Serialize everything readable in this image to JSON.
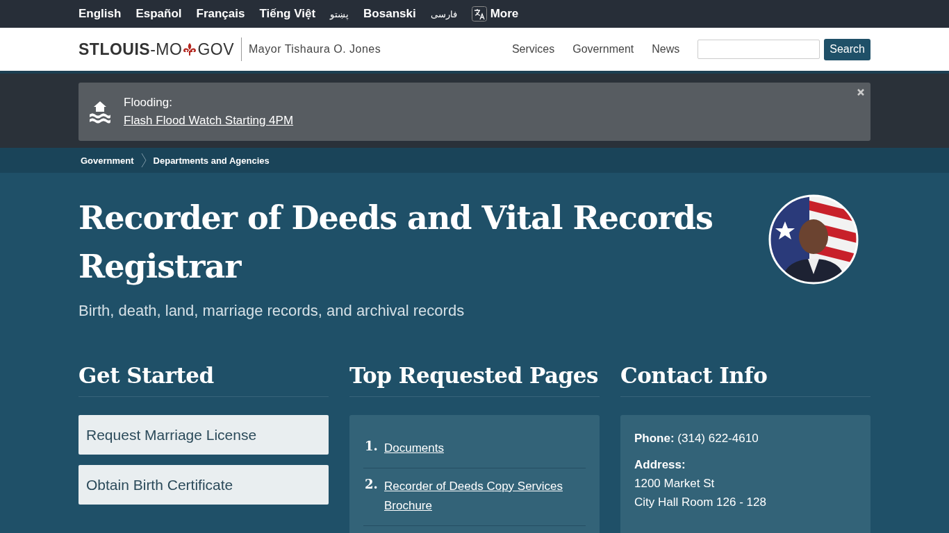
{
  "languages": [
    {
      "label": "English",
      "rtl": false
    },
    {
      "label": "Español",
      "rtl": false
    },
    {
      "label": "Français",
      "rtl": false
    },
    {
      "label": "Tiếng Việt",
      "rtl": false
    },
    {
      "label": "پښتو",
      "rtl": true
    },
    {
      "label": "Bosanski",
      "rtl": false
    },
    {
      "label": "فارسی",
      "rtl": true
    }
  ],
  "more": {
    "label": "More"
  },
  "header": {
    "logo": {
      "bold": "STLOUIS",
      "middle": "-MO",
      "end": "GOV"
    },
    "mayor": "Mayor Tishaura O. Jones",
    "nav": [
      "Services",
      "Government",
      "News"
    ],
    "search": {
      "button": "Search"
    }
  },
  "alert": {
    "title": "Flooding:",
    "link": "Flash Flood Watch Starting 4PM"
  },
  "breadcrumb": [
    "Government",
    "Departments and Agencies"
  ],
  "hero": {
    "title": "Recorder of Deeds and Vital Records Registrar",
    "subtitle": "Birth, death, land, marriage records, and archival records"
  },
  "get_started": {
    "heading": "Get Started",
    "buttons": [
      "Request Marriage License",
      "Obtain Birth Certificate"
    ]
  },
  "top_pages": {
    "heading": "Top Requested Pages",
    "items": [
      {
        "number": "1.",
        "label": "Documents"
      },
      {
        "number": "2.",
        "label": "Recorder of Deeds Copy Services Brochure"
      }
    ]
  },
  "contact": {
    "heading": "Contact Info",
    "phone_label": "Phone:",
    "phone": "(314) 622-4610",
    "address_label": "Address:",
    "address_lines": [
      "1200 Market St",
      "City Hall Room 126 - 128"
    ]
  }
}
